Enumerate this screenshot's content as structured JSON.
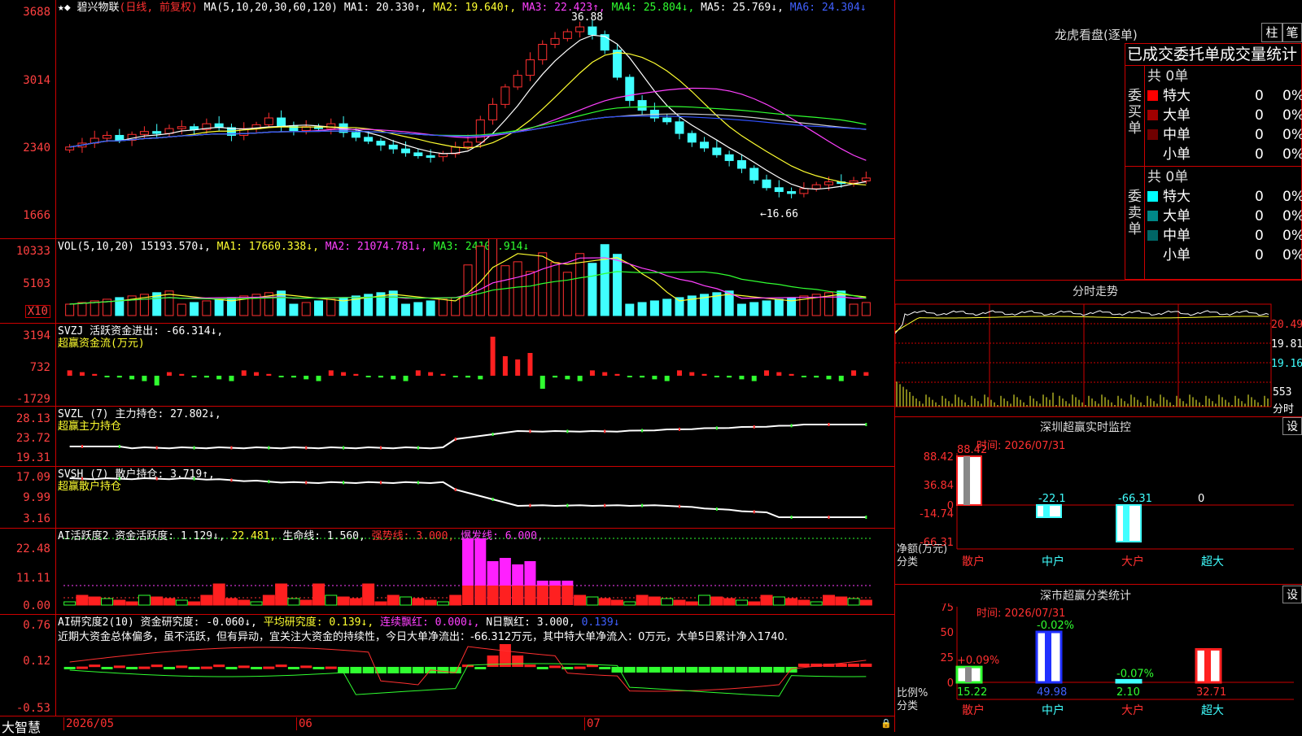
{
  "stock": {
    "name": "碧兴物联",
    "mode": "(日线, 前复权)",
    "ma_label": "MA(5,10,20,30,60,120)",
    "ma": [
      {
        "label": "MA1: 20.330↑,",
        "color": "#ffffff"
      },
      {
        "label": "MA2: 19.640↑,",
        "color": "#ffff30"
      },
      {
        "label": "MA3: 22.423↑,",
        "color": "#ff40ff"
      },
      {
        "label": "MA4: 25.804↓,",
        "color": "#30ff30"
      },
      {
        "label": "MA5: 25.769↓,",
        "color": "#ffffff"
      },
      {
        "label": "MA6: 24.304↓",
        "color": "#4060ff"
      }
    ],
    "yticks": [
      "3688",
      "3014",
      "2340",
      "1666"
    ],
    "hi_label": "36.88",
    "lo_label": "←16.66"
  },
  "vol": {
    "label": "VOL(5,10,20)",
    "value": "15193.570↓,",
    "ma1": "MA1: 17660.338↓,",
    "ma2": "MA2: 21074.781↓,",
    "ma3": "MA3: 24104.914↓",
    "yticks": [
      "10333",
      "5103"
    ],
    "unit": "X10"
  },
  "svzj": {
    "label": "SVZJ  活跃资金进出: -66.314↓,",
    "sub": "超赢资金流(万元)",
    "yticks": [
      "3194",
      "732",
      "-1729"
    ]
  },
  "svzl": {
    "label": "SVZL (7) 主力持仓: 27.802↓,",
    "sub": "超赢主力持仓",
    "yticks": [
      "28.13",
      "23.72",
      "19.31"
    ]
  },
  "svsh": {
    "label": "SVSH (7) 散户持仓: 3.719↑,",
    "sub": "超赢散户持仓",
    "yticks": [
      "17.09",
      "9.99",
      "3.16"
    ]
  },
  "ai2": {
    "label": "AI活跃度2 资金活跃度: 1.129↓,",
    "v2": "22.481,",
    "v3": "生命线: 1.560,",
    "v4": "强势线: 3.000,",
    "v5": "爆发线: 6.000,",
    "yticks": [
      "22.48",
      "11.11",
      "0.00"
    ]
  },
  "ai3": {
    "label": "AI研究度2(10) 资金研究度: -0.060↓,",
    "v2": "平均研究度: 0.139↓,",
    "v3": "连续飘红: 0.000↓,",
    "v4": "N日飘红: 3.000,",
    "v5": "0.139↓",
    "yticks": [
      "0.76",
      "0.12",
      "-0.53"
    ],
    "comment": "近期大资金总体偏多，虽不活跃，但有异动，宜关注大资金的持续性，今日大单净流出：-66.312万元，其中特大单净流入：0万元，大单5日累计净入1740."
  },
  "xaxis": {
    "brand": "大智慧",
    "labels": [
      "2026/05",
      "06",
      "07"
    ]
  },
  "lhb": {
    "title": "龙虎看盘(逐单)",
    "btn1": "柱",
    "btn2": "笔",
    "header": "已成交委托单成交量统计",
    "buy": {
      "side": "委买单",
      "total": "共 0单",
      "rows": [
        {
          "name": "特大",
          "v": "0",
          "p": "0%",
          "color": "#ff0000"
        },
        {
          "name": "大单",
          "v": "0",
          "p": "0%",
          "color": "#a00000"
        },
        {
          "name": "中单",
          "v": "0",
          "p": "0%",
          "color": "#700000"
        },
        {
          "name": "小单",
          "v": "0",
          "p": "0%",
          "color": "#000000"
        }
      ]
    },
    "sell": {
      "side": "委卖单",
      "total": "共 0单",
      "rows": [
        {
          "name": "特大",
          "v": "0",
          "p": "0%",
          "color": "#00ffff"
        },
        {
          "name": "大单",
          "v": "0",
          "p": "0%",
          "color": "#008888"
        },
        {
          "name": "中单",
          "v": "0",
          "p": "0%",
          "color": "#006666"
        },
        {
          "name": "小单",
          "v": "0",
          "p": "0%",
          "color": "#000000"
        }
      ]
    }
  },
  "fenshi": {
    "title": "分时走势",
    "yticks": [
      "20.49",
      "19.81",
      "19.16"
    ],
    "vol": "553",
    "unit": "分时"
  },
  "monitor": {
    "title": "深圳超赢实时监控",
    "btn": "设",
    "time": "时间: 2026/07/31",
    "yticks": [
      "88.42",
      "36.84",
      "0",
      "-14.74",
      "-66.31"
    ],
    "ylabel": "净额(万元)",
    "xlabel": "分类",
    "cats": [
      "散户",
      "中户",
      "大户",
      "超大"
    ],
    "vals": [
      "88.42",
      "-22.1",
      "-66.31",
      "0"
    ]
  },
  "classify": {
    "title": "深市超赢分类统计",
    "btn": "设",
    "time": "时间: 2026/07/31",
    "yticks": [
      "75",
      "50",
      "25",
      "0"
    ],
    "ylabel": "比例%",
    "xlabel": "分类",
    "cats": [
      "散户",
      "中户",
      "大户",
      "超大"
    ],
    "vals": [
      "15.22",
      "49.98",
      "2.10",
      "32.71"
    ],
    "chg": [
      "+0.09%",
      "-0.02%",
      "-0.07%",
      ""
    ]
  },
  "chart_data": {
    "type": "bar",
    "title": "碧兴物联",
    "categories": [
      "散户",
      "中户",
      "大户",
      "超大"
    ],
    "series": [
      {
        "name": "净额(万元)",
        "values": [
          88.42,
          -22.1,
          -66.31,
          0
        ]
      },
      {
        "name": "比例%",
        "values": [
          15.22,
          49.98,
          2.1,
          32.71
        ]
      }
    ]
  }
}
